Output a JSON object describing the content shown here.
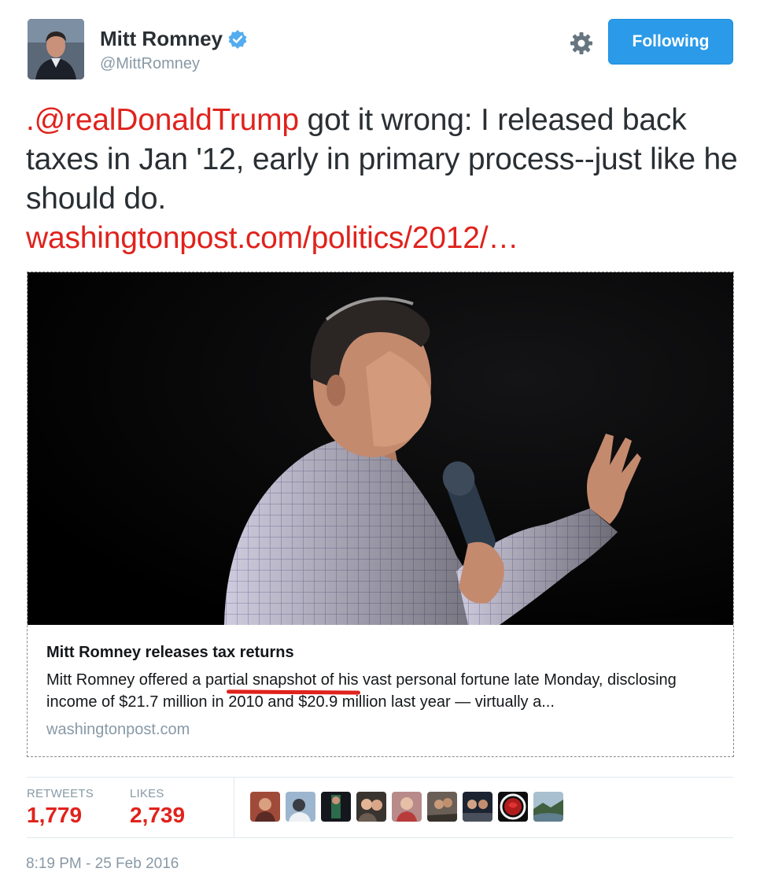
{
  "user": {
    "name": "Mitt Romney",
    "handle": "@MittRomney",
    "verified": true
  },
  "follow_button": {
    "label": "Following",
    "color": "#2b9ae8"
  },
  "tweet": {
    "mention": ".@realDonaldTrump",
    "text": " got it wrong: I released back taxes in Jan '12, early in primary process--just like he should do.",
    "link": "washingtonpost.com/politics/2012/…",
    "link_color": "#e0221c"
  },
  "card": {
    "title": "Mitt Romney releases tax returns",
    "description": "Mitt Romney offered a partial snapshot of his vast personal fortune late Monday, disclosing income of $21.7 million in 2010 and $20.9 million last year — virtually a...",
    "domain": "washingtonpost.com"
  },
  "stats": {
    "retweets_label": "RETWEETS",
    "retweets": "1,779",
    "likes_label": "LIKES",
    "likes": "2,739"
  },
  "likers": [
    {
      "icon": "avatar-1"
    },
    {
      "icon": "avatar-2"
    },
    {
      "icon": "avatar-3"
    },
    {
      "icon": "avatar-4"
    },
    {
      "icon": "avatar-5"
    },
    {
      "icon": "avatar-6"
    },
    {
      "icon": "avatar-7"
    },
    {
      "icon": "avatar-8"
    },
    {
      "icon": "avatar-9"
    }
  ],
  "timestamp": "8:19 PM - 25 Feb 2016"
}
